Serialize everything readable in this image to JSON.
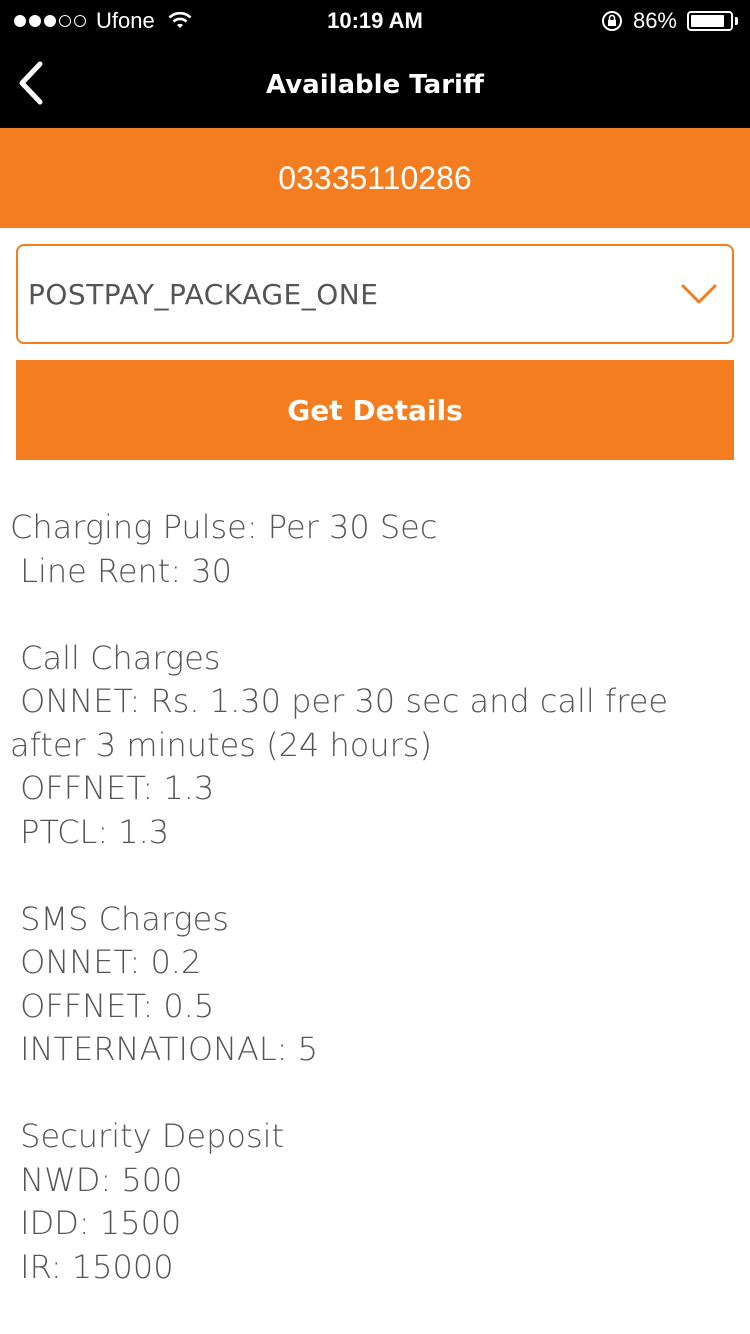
{
  "status_bar": {
    "carrier": "Ufone",
    "time": "10:19 AM",
    "battery_percent": "86%",
    "battery_level": 0.86,
    "signal_bars_filled": 3,
    "signal_bars_total": 5
  },
  "nav": {
    "title": "Available Tariff",
    "back_icon": "chevron-left-icon"
  },
  "phone_number": "03335110286",
  "package_select": {
    "value": "POSTPAY_PACKAGE_ONE",
    "icon": "chevron-down-icon"
  },
  "get_details_label": "Get Details",
  "details": {
    "charging_pulse": "Charging Pulse: Per 30 Sec",
    "line_rent": " Line Rent: 30",
    "call_heading": " Call Charges",
    "call_onnet_1": " ONNET: Rs. 1.30 per 30 sec and call free",
    "call_onnet_2": "after 3 minutes (24 hours)",
    "call_offnet": " OFFNET: 1.3",
    "call_ptcl": " PTCL: 1.3",
    "sms_heading": " SMS Charges",
    "sms_onnet": " ONNET: 0.2",
    "sms_offnet": " OFFNET: 0.5",
    "sms_international": " INTERNATIONAL: 5",
    "deposit_heading": " Security Deposit",
    "deposit_nwd": " NWD: 500",
    "deposit_idd": " IDD: 1500",
    "deposit_ir": " IR: 15000"
  },
  "colors": {
    "accent": "#f47d20",
    "bar": "#000000",
    "text": "#555555"
  }
}
